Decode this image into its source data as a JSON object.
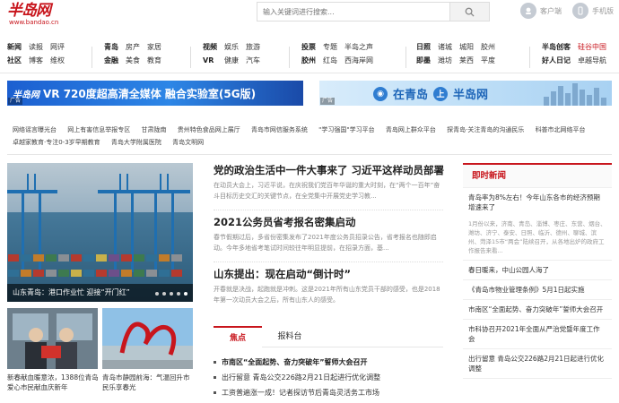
{
  "header": {
    "logo_text": "半岛网",
    "logo_url": "www.bandao.cn",
    "search_placeholder": "输入关键词进行搜索...",
    "client_label": "客户端",
    "mobile_label": "手机版"
  },
  "nav": {
    "g1": [
      "新闻",
      "读报",
      "网评",
      "社区",
      "博客",
      "维权"
    ],
    "g2": [
      "青岛",
      "房产",
      "家居",
      "金融",
      "美食",
      "教育"
    ],
    "g3": [
      "视频",
      "娱乐",
      "旅游",
      "VR",
      "健康",
      "汽车"
    ],
    "g4": [
      "投票",
      "专题",
      "半岛之声",
      "胶州",
      "红岛",
      "西海岸网"
    ],
    "g5": [
      "日照",
      "诸城",
      "城阳",
      "胶州",
      "即墨",
      "潍坊",
      "莱西",
      "平度"
    ],
    "g6": [
      "半岛创客",
      "硅谷中国",
      "好人日记",
      "卓越导航"
    ]
  },
  "banners": {
    "left_logo": "半岛网",
    "left_text": "VR 720度超高清全媒体  融合实验室(5G版)",
    "left_tag": "广告",
    "right_text_a": "在青岛",
    "right_text_b": "半岛网",
    "right_icon_glyph": "上",
    "right_tag": "广告"
  },
  "link_rows": [
    [
      "网络谣言曝光台",
      "网上有害信息举报专区",
      "甘肃陇南",
      "贵州特色食品网上展厅",
      "青岛市网信服务系统",
      "\"学习强国\"学习平台",
      "青岛网上群众平台",
      "探青岛·关注青岛的沟通民乐",
      "科普市北网络平台"
    ],
    [
      "卓越家教育·专注0-3岁早期教育",
      "青岛大学附属医院",
      "青岛文明网"
    ]
  ],
  "slider": {
    "caption": "山东青岛：港口作业忙 迎接“开门红”"
  },
  "thumbs": [
    {
      "caption": "新春献血暖意浓，1388位青岛爱心市民献血庆新年"
    },
    {
      "caption": "青岛市静园前海：气温回升市民乐享春光"
    }
  ],
  "headlines": [
    {
      "title": "党的政治生活中一件大事来了 习近平这样动员部署",
      "desc": "在动员大会上，习近平说，在庆祝我们党百年华诞的重大时刻，在“两个一百年”奋斗目标历史交汇的关键节点，在全党集中开展党史学习教..."
    },
    {
      "title": "2021公务员省考报名密集启动",
      "desc": "春节假期过后，多省份密集发布了2021年度公务员招录公告，省考报名也随即启动。今年多地省考笔试时间较往年明显提前，在招录方面，基..."
    },
    {
      "title": "山东提出：现在启动“倒计时”",
      "desc": "开春就是决战，起跑就是冲刺。这是2021年所有山东党员干部的感受，也是2018年第一次动员大会之后，所有山东人的感受。"
    }
  ],
  "tabs": [
    "焦点",
    "报料台"
  ],
  "news_list": [
    "市南区“全面起势、奋力突破年”誓师大会召开",
    "出行留意 青岛公交226路2月21日起进行优化调整",
    "工资普遍涨一成！记者探访节后青岛灵活务工市场"
  ],
  "instant_news": {
    "header": "即时新闻",
    "top": "青岛率为8%左右！今年山东各市的经济预期增速来了",
    "top_sub": "1月份以来，济南、青岛、淄博、枣庄、东营、烟台、潍坊、济宁、泰安、日照、临沂、德州、聊城、滨州、菏泽15市“两会”陆续召开，从各地出炉的政府工作报告来看...",
    "items": [
      "春日暖来，中山公园人海了",
      "《青岛市物业管理条例》5月1日起实施",
      "市南区“全面起势、奋力突破年”誓师大会召开",
      "市科协召开2021年全面从严治党暨年度工作会",
      "出行留意 青岛公交226路2月21日起进行优化调整"
    ]
  },
  "colors": {
    "brand_red": "#c8161d"
  }
}
